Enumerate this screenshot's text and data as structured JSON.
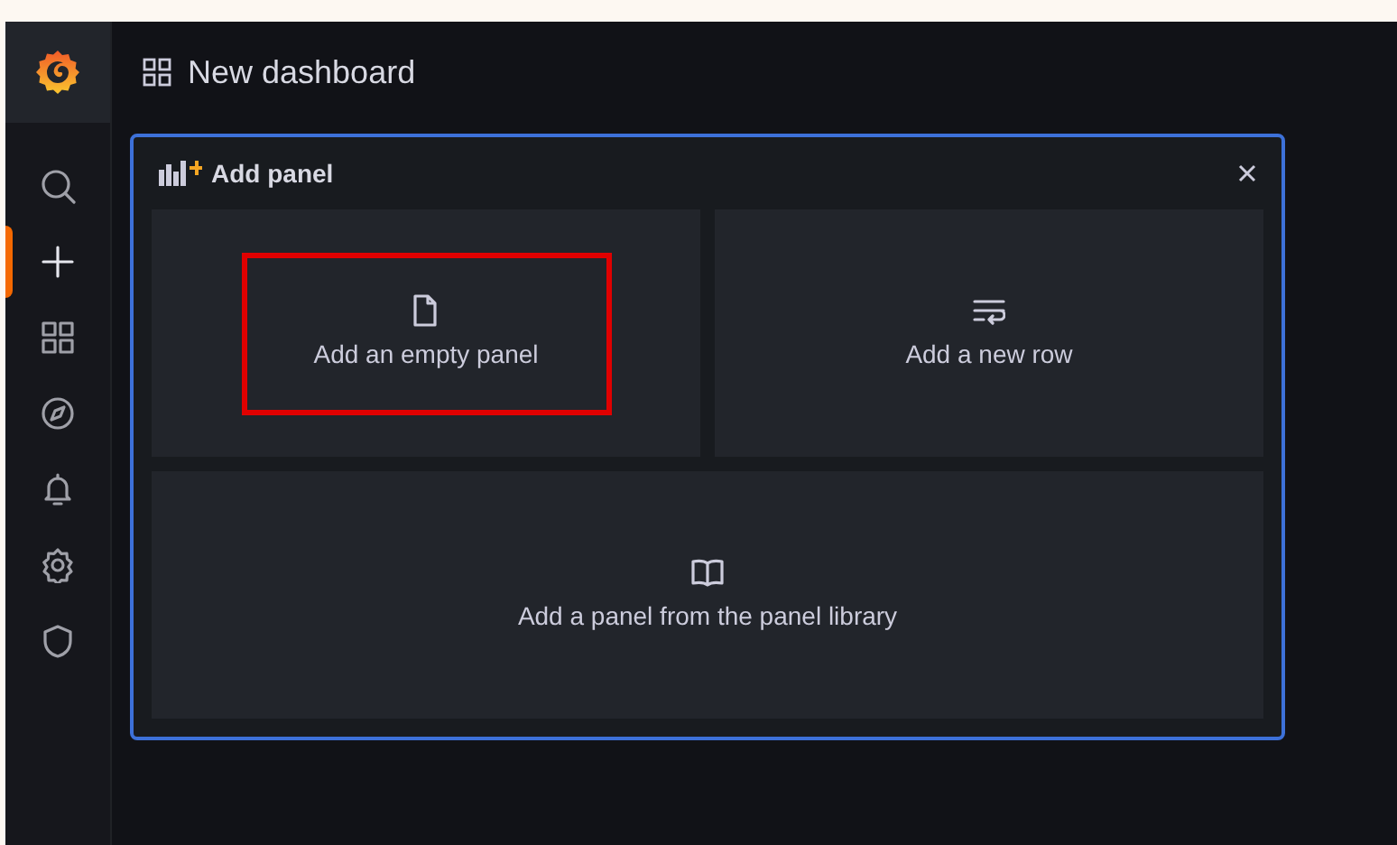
{
  "sidebar": {
    "items": [
      {
        "kind": "search",
        "selected": false
      },
      {
        "kind": "plus",
        "selected": true
      },
      {
        "kind": "dashboards",
        "selected": false
      },
      {
        "kind": "explore",
        "selected": false
      },
      {
        "kind": "alerting",
        "selected": false
      },
      {
        "kind": "settings",
        "selected": false
      },
      {
        "kind": "shield",
        "selected": false
      }
    ]
  },
  "header": {
    "title": "New dashboard"
  },
  "add_panel": {
    "title": "Add panel",
    "options": [
      {
        "kind": "empty",
        "label": "Add an empty panel",
        "highlighted": true
      },
      {
        "kind": "row",
        "label": "Add a new row",
        "highlighted": false
      },
      {
        "kind": "library",
        "label": "Add a panel from the panel library",
        "highlighted": false
      }
    ]
  }
}
